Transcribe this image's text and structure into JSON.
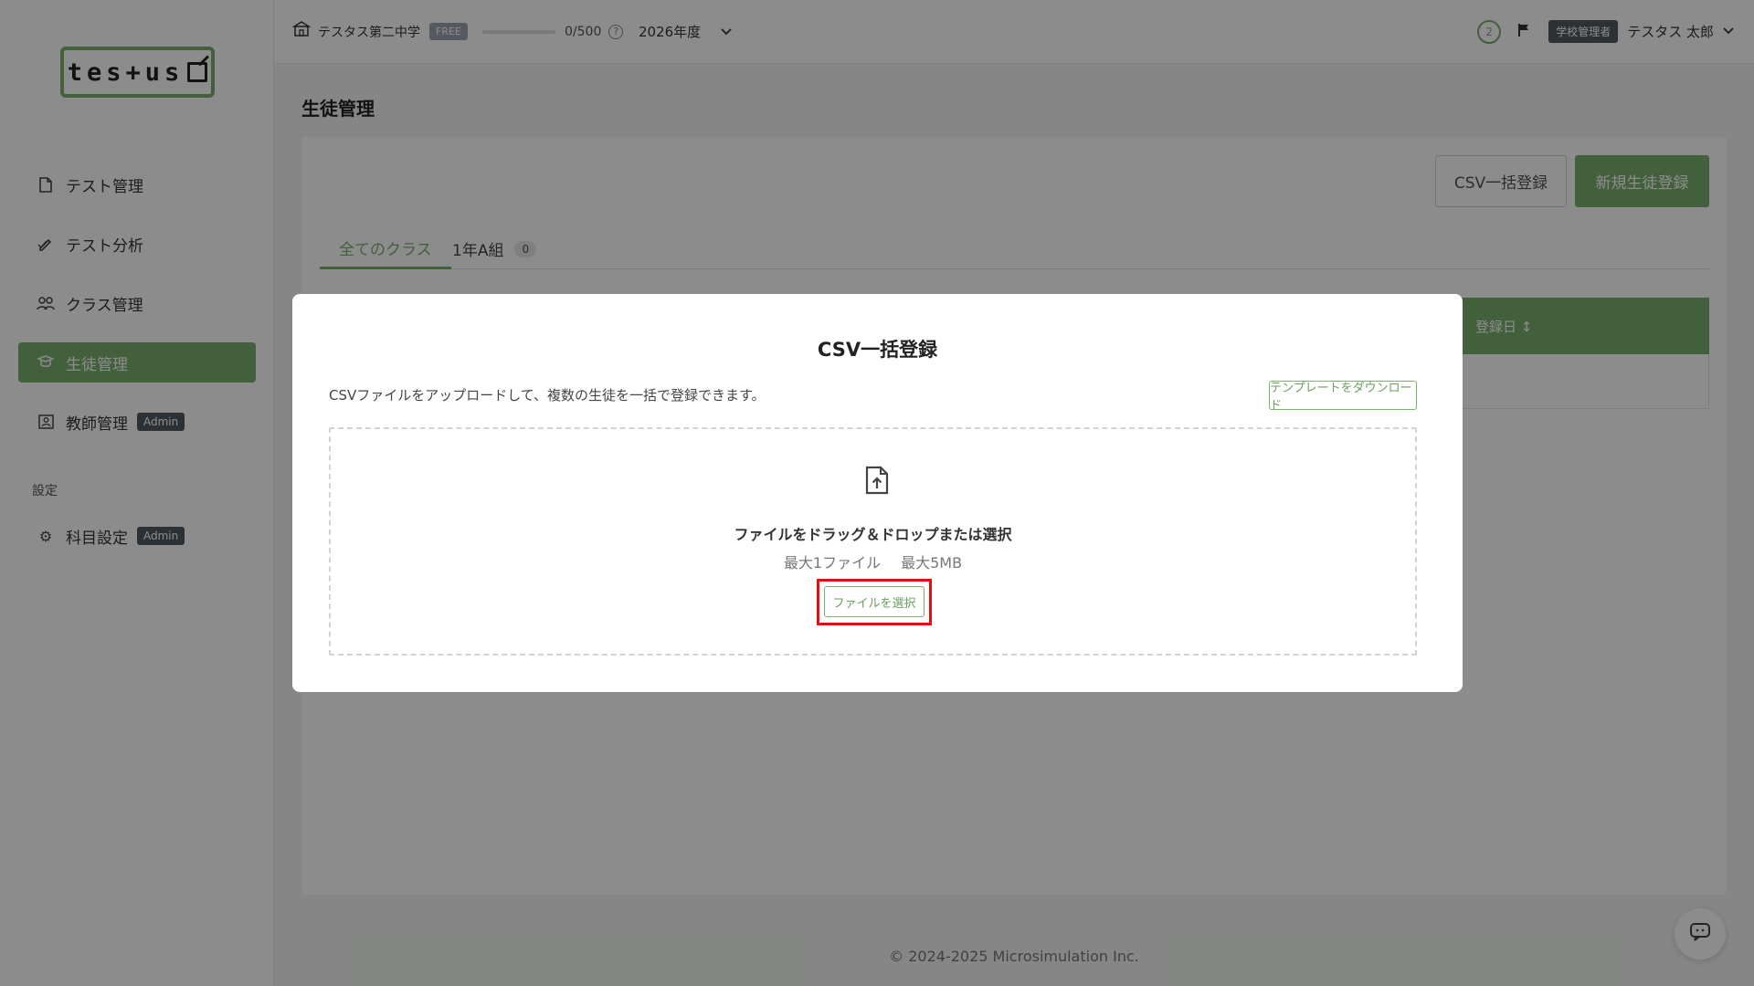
{
  "app": {
    "logo_text": "tes+us"
  },
  "header": {
    "school_name": "テスタス第二中学",
    "plan_badge": "FREE",
    "usage_text": "0/500",
    "usage_fraction": 0,
    "help_symbol": "?",
    "year_select": "2026年度",
    "notification_count": "2",
    "role_badge": "学校管理者",
    "user_name": "テスタス 太郎"
  },
  "sidebar": {
    "items": [
      {
        "label": "テスト管理",
        "icon": "document-icon"
      },
      {
        "label": "テスト分析",
        "icon": "pen-check-icon"
      },
      {
        "label": "クラス管理",
        "icon": "group-icon"
      },
      {
        "label": "生徒管理",
        "icon": "student-icon",
        "active": true
      },
      {
        "label": "教師管理",
        "icon": "teacher-icon",
        "badge": "Admin"
      }
    ],
    "settings_label": "設定",
    "settings_items": [
      {
        "label": "科目設定",
        "icon": "gear-icon",
        "badge": "Admin"
      }
    ]
  },
  "main": {
    "page_title": "生徒管理",
    "csv_button": "CSV一括登録",
    "new_button": "新規生徒登録",
    "tabs": [
      {
        "label": "全てのクラス",
        "active": true
      },
      {
        "label": "1年A組",
        "count": "0"
      }
    ],
    "table": {
      "visible_header": "登録日 ↕"
    }
  },
  "footer": {
    "copyright": "© 2024-2025 Microsimulation Inc."
  },
  "modal": {
    "title": "CSV一括登録",
    "description": "CSVファイルをアップロードして、複数の生徒を一括で登録できます。",
    "template_button": "テンプレートをダウンロード",
    "dropzone": {
      "title": "ファイルをドラッグ＆ドロップまたは選択",
      "max_files": "最大1ファイル",
      "max_size": "最大5MB",
      "select_button": "ファイルを選択"
    }
  },
  "colors": {
    "accent": "#7bb06e",
    "highlight": "#e01010",
    "badge_dark": "#4f5a60"
  }
}
